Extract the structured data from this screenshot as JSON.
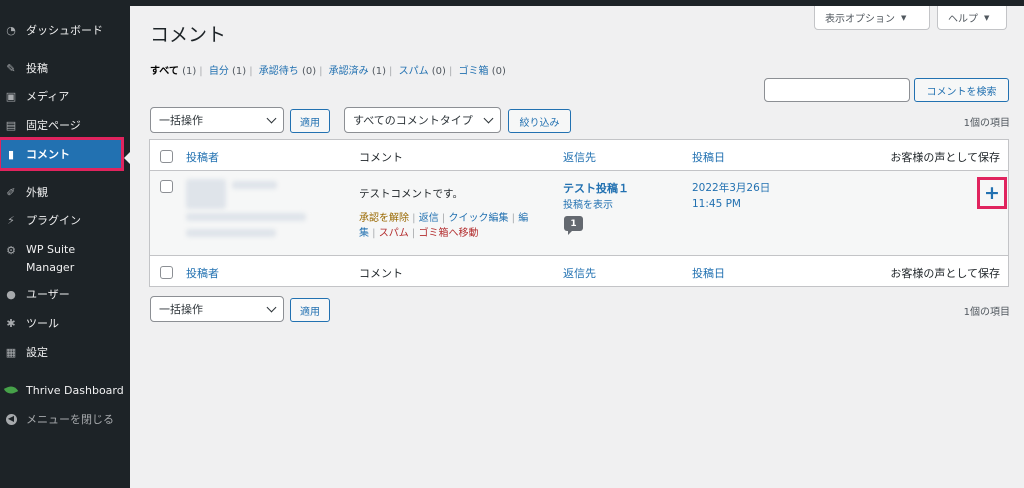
{
  "sidebar": {
    "items": [
      {
        "label": "ダッシュボード",
        "icon": "dashboard-icon"
      },
      {
        "label": "投稿",
        "icon": "pin-icon"
      },
      {
        "label": "メディア",
        "icon": "media-icon"
      },
      {
        "label": "固定ページ",
        "icon": "page-icon"
      },
      {
        "label": "コメント",
        "icon": "comment-icon"
      },
      {
        "label": "外観",
        "icon": "appearance-icon"
      },
      {
        "label": "プラグイン",
        "icon": "plugin-icon"
      },
      {
        "label": "WP Suite Manager",
        "icon": "gear-icon"
      },
      {
        "label": "ユーザー",
        "icon": "user-icon"
      },
      {
        "label": "ツール",
        "icon": "wrench-icon"
      },
      {
        "label": "設定",
        "icon": "settings-icon"
      },
      {
        "label": "Thrive Dashboard",
        "icon": "leaf-icon"
      },
      {
        "label": "メニューを閉じる",
        "icon": "collapse-icon"
      }
    ]
  },
  "header": {
    "title": "コメント",
    "screen_options": "表示オプション",
    "help": "ヘルプ"
  },
  "filters": [
    {
      "label": "すべて",
      "count": "(1)"
    },
    {
      "label": "自分",
      "count": "(1)"
    },
    {
      "label": "承認待ち",
      "count": "(0)"
    },
    {
      "label": "承認済み",
      "count": "(1)"
    },
    {
      "label": "スパム",
      "count": "(0)"
    },
    {
      "label": "ゴミ箱",
      "count": "(0)"
    }
  ],
  "search": {
    "button": "コメントを検索",
    "placeholder": ""
  },
  "top_nav": {
    "bulk_action": "一括操作",
    "apply": "適用",
    "comment_type": "すべてのコメントタイプ",
    "filter": "絞り込み",
    "items_count": "1個の項目"
  },
  "bottom_nav": {
    "bulk_action": "一括操作",
    "apply": "適用",
    "items_count": "1個の項目"
  },
  "table": {
    "columns": [
      "投稿者",
      "コメント",
      "返信先",
      "投稿日",
      "お客様の声として保存"
    ],
    "row": {
      "comment": "テストコメントです。",
      "actions": {
        "unapprove": "承認を解除",
        "reply": "返信",
        "quick_edit": "クイック編集",
        "edit_1": "編",
        "edit_2": "集",
        "spam": "スパム",
        "trash": "ゴミ箱へ移動"
      },
      "post_title": "テスト投稿１",
      "view_post": "投稿を表示",
      "comment_count": "1",
      "date_line1": "2022年3月26日",
      "date_line2": "11:45 PM",
      "save_symbol": "+"
    }
  },
  "colors": {
    "accent": "#2271b1",
    "highlight": "#e0245e",
    "sidebar": "#1d2327"
  }
}
